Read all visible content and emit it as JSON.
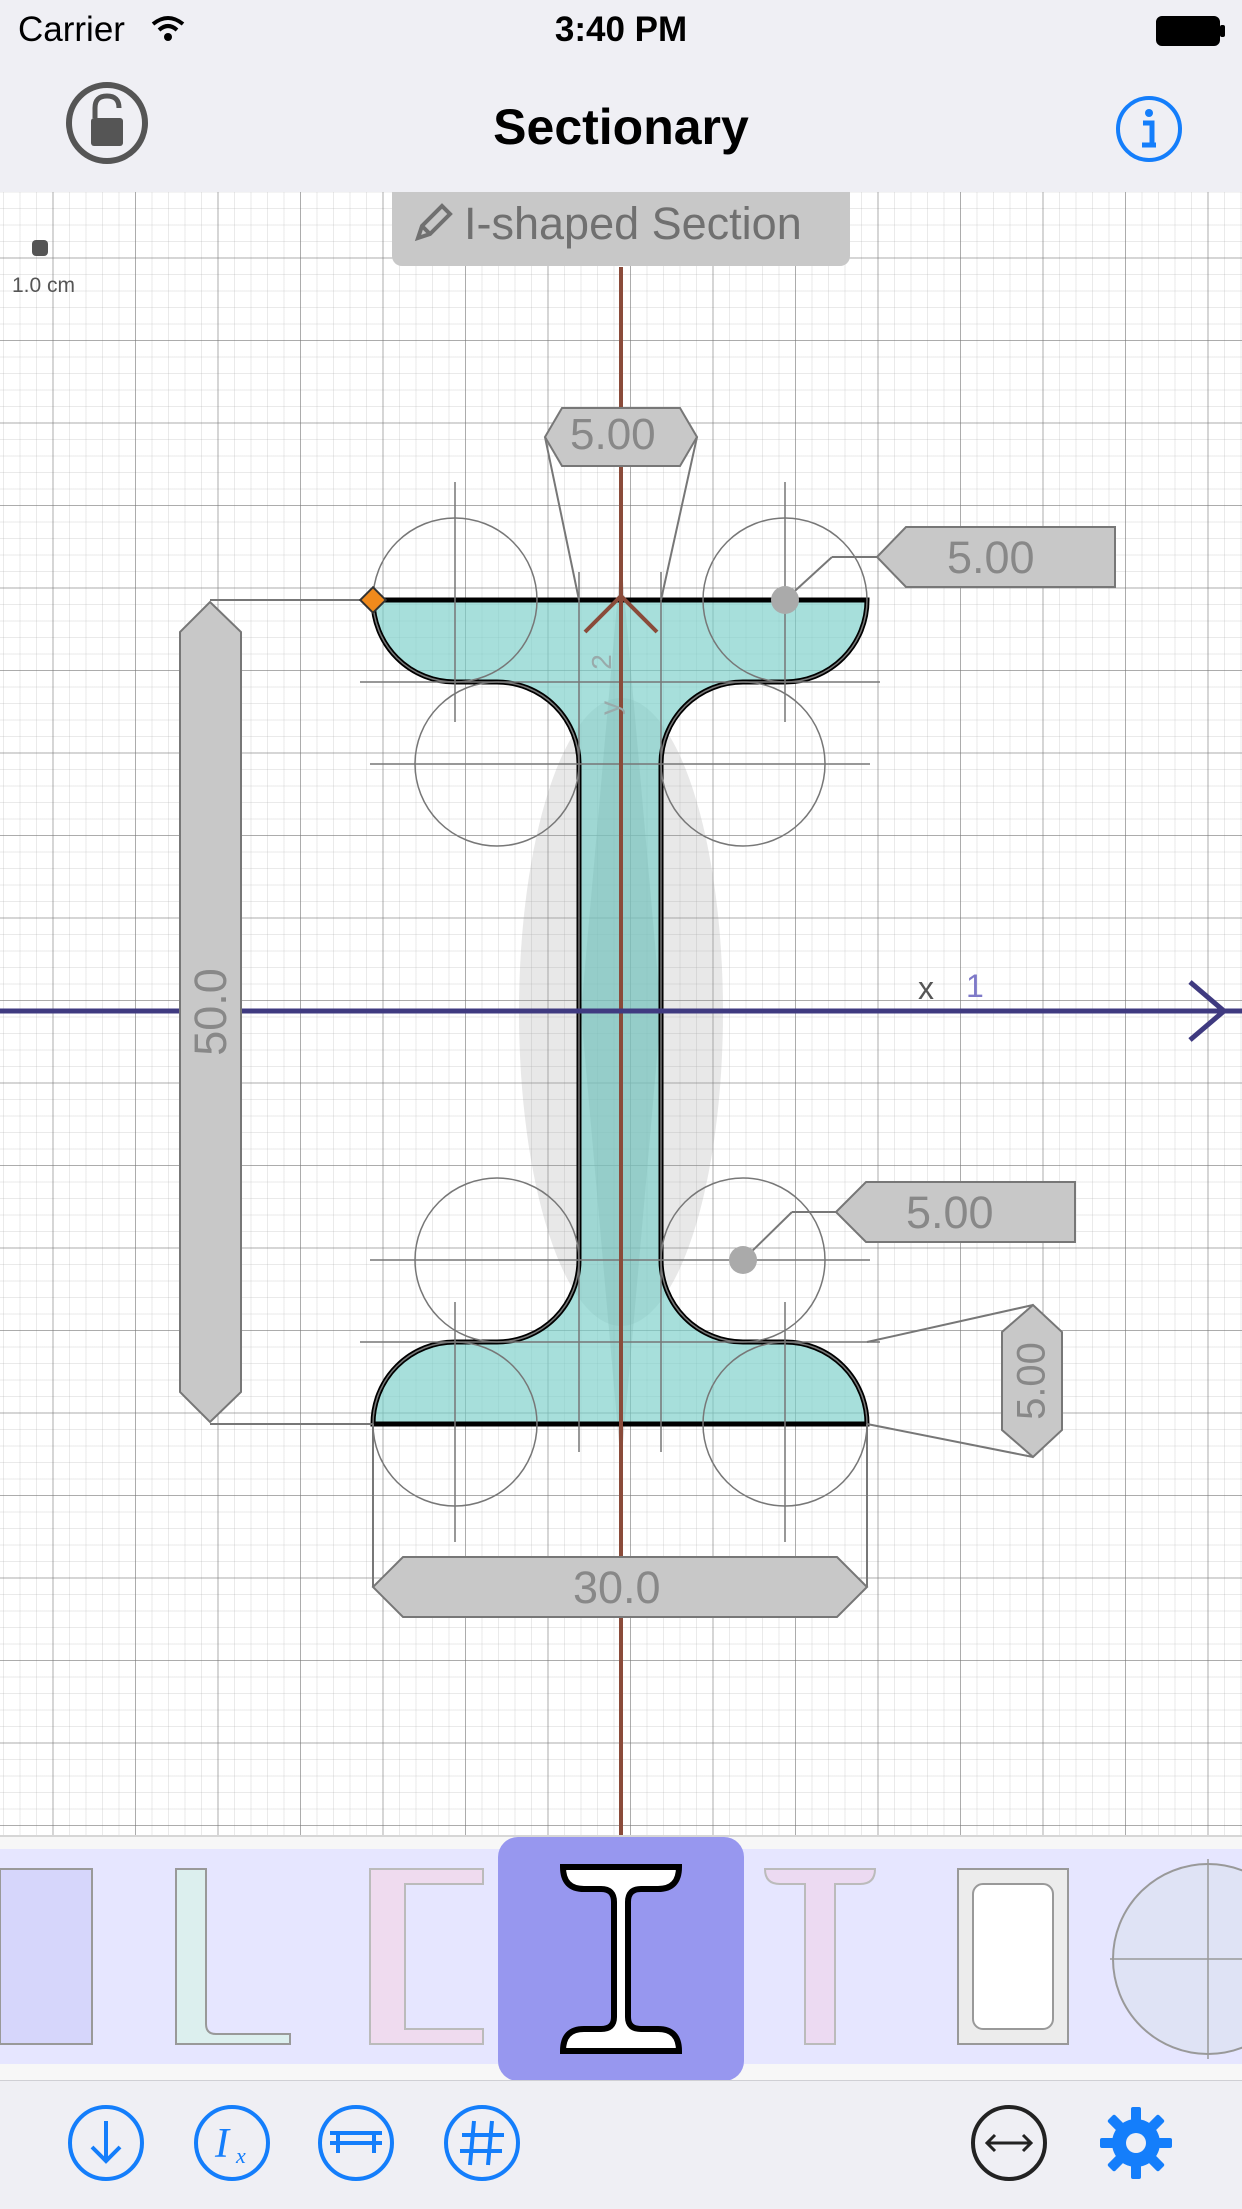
{
  "status_bar": {
    "carrier": "Carrier",
    "time": "3:40 PM"
  },
  "nav": {
    "title": "Sectionary",
    "left_icon": "lock-open-icon",
    "right_icon": "info-icon"
  },
  "canvas": {
    "scale_label": "1.0 cm",
    "section_title": "I-shaped Section",
    "dimensions": {
      "flange_thickness_top": "5.00",
      "root_radius_top": "5.00",
      "height": "50.0",
      "root_radius_bottom": "5.00",
      "flange_thickness_bottom": "5.00",
      "width": "30.0"
    },
    "axes": {
      "x_label": "x",
      "x_number": "1",
      "y_label": "y",
      "y_number": "2"
    }
  },
  "shape_tray": {
    "items": [
      "rectangle",
      "L-shape",
      "C-shape",
      "I-shape",
      "T-shape",
      "hollow-rectangle",
      "circle"
    ],
    "selected": "I-shape"
  },
  "toolbar": {
    "left": [
      "download-icon",
      "moment-of-inertia-icon",
      "section-measure-icon",
      "grid-icon"
    ],
    "right": [
      "resize-arrows-icon",
      "gear-icon"
    ]
  },
  "colors": {
    "accent": "#147efb",
    "fill": "#9ed9d5",
    "x_axis": "#3f3a80",
    "y_axis": "#8a4b3a",
    "selected_tile": "#9797ef",
    "tray_bg": "#e6e6ff"
  }
}
